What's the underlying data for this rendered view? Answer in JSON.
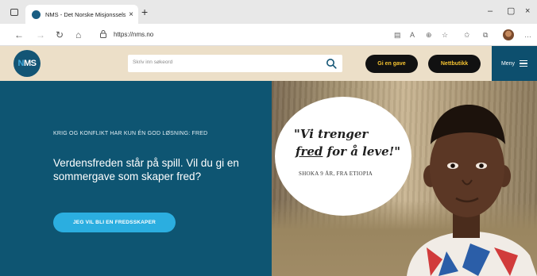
{
  "browser": {
    "tab_title": "NMS - Det Norske Misjonsselsk",
    "tab_close": "×",
    "new_tab": "+",
    "url": "https://nms.no",
    "window_controls": {
      "minimize": "–",
      "maximize": "▢",
      "close": "×"
    }
  },
  "site": {
    "logo_text": {
      "n": "N",
      "ms": "MS"
    },
    "search_placeholder": "Skriv inn søkeord",
    "gift_button": "Gi en gave",
    "shop_button": "Nettbutikk",
    "menu_label": "Meny"
  },
  "hero": {
    "kicker": "KRIG OG KONFLIKT HAR KUN ÉN GOD LØSNING: FRED",
    "headline": "Verdensfreden står på spill. Vil du gi en sommergave som skaper fred?",
    "cta": "JEG VIL BLI EN FREDSSKAPER",
    "quote_line1": "\"Vi trenger",
    "quote_fred": "fred",
    "quote_rest": " for å leve!\"",
    "attribution": "SHOKA 9 ÅR, FRA ETIOPIA"
  },
  "colors": {
    "brand_blue": "#0e5572",
    "header_beige": "#ecdfc8",
    "button_black": "#111111",
    "button_text_yellow": "#f4c230",
    "cta_light_blue": "#2baee0"
  },
  "icons": [
    "window-icon",
    "favicon",
    "back-icon",
    "forward-icon",
    "refresh-icon",
    "home-icon",
    "lock-icon",
    "search-icon",
    "menu-icon"
  ]
}
